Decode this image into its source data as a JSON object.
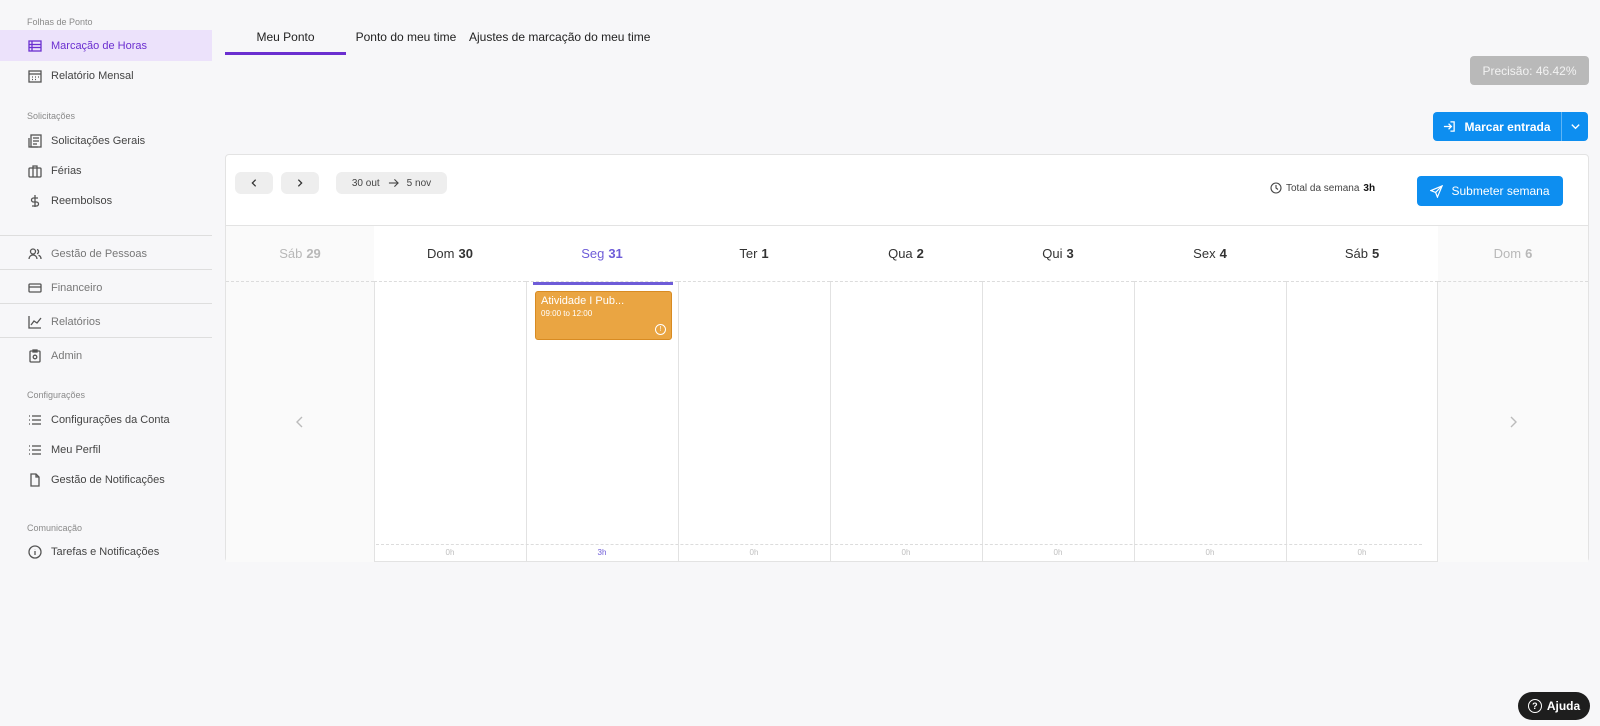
{
  "sidebar": {
    "sections": {
      "folhas": "Folhas de Ponto",
      "solicitacoes": "Solicitações",
      "configuracoes": "Configurações",
      "comunicacao": "Comunicação"
    },
    "items": {
      "marcacao": "Marcação de Horas",
      "relatorio_mensal": "Relatório Mensal",
      "solicitacoes_gerais": "Solicitações Gerais",
      "ferias": "Férias",
      "reembolsos": "Reembolsos",
      "gestao_pessoas": "Gestão de Pessoas",
      "financeiro": "Financeiro",
      "relatorios": "Relatórios",
      "admin": "Admin",
      "config_conta": "Configurações da Conta",
      "meu_perfil": "Meu Perfil",
      "gestao_notificacoes": "Gestão de Notificações",
      "tarefas": "Tarefas e Notificações"
    }
  },
  "tabs": {
    "meu_ponto": "Meu Ponto",
    "ponto_time": "Ponto do meu time",
    "ajustes": "Ajustes de marcação do meu time"
  },
  "precisao": "Precisão: 46.42%",
  "marcar_entrada": "Marcar entrada",
  "calendar": {
    "range_start": "30 out",
    "range_end": "5 nov",
    "total_label": "Total da semana",
    "total_value": "3h",
    "submit": "Submeter semana",
    "days": [
      {
        "name": "Sáb",
        "num": "29"
      },
      {
        "name": "Dom",
        "num": "30",
        "hours": "0h"
      },
      {
        "name": "Seg",
        "num": "31",
        "hours": "3h"
      },
      {
        "name": "Ter",
        "num": "1",
        "hours": "0h"
      },
      {
        "name": "Qua",
        "num": "2",
        "hours": "0h"
      },
      {
        "name": "Qui",
        "num": "3",
        "hours": "0h"
      },
      {
        "name": "Sex",
        "num": "4",
        "hours": "0h"
      },
      {
        "name": "Sáb",
        "num": "5",
        "hours": "0h"
      },
      {
        "name": "Dom",
        "num": "6"
      }
    ],
    "event": {
      "title": "Atividade I Pub...",
      "time": "09:00 to 12:00"
    }
  },
  "help": "Ajuda",
  "colors": {
    "accent": "#6b2fd0",
    "primary_button": "#0d8ef0",
    "event": "#eaa542"
  }
}
